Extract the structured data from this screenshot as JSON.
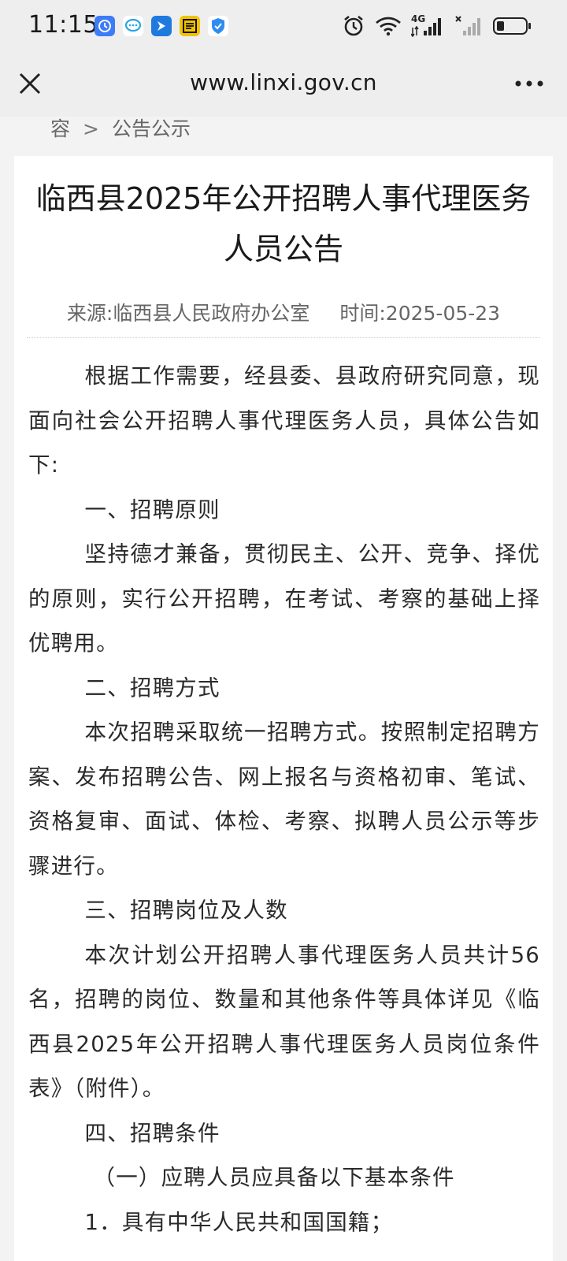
{
  "status_bar": {
    "time": "11:15",
    "app_icons": [
      {
        "name": "clock-app-icon",
        "color": "#3d7bf7",
        "glyph": "⏰"
      },
      {
        "name": "chat-app-icon",
        "color": "#ffffff",
        "glyph": "💬"
      },
      {
        "name": "arrow-app-icon",
        "color": "#1f7ae0",
        "glyph": "➤"
      },
      {
        "name": "news-app-icon",
        "color": "#f2c200",
        "glyph": "哔"
      },
      {
        "name": "shield-app-icon",
        "color": "#ffffff",
        "glyph": "🛡"
      }
    ],
    "network_label": "4G",
    "battery_level": 0.25
  },
  "nav": {
    "url": "www.linxi.gov.cn"
  },
  "breadcrumb": {
    "prev": "容",
    "separator": ">",
    "current": "公告公示"
  },
  "article": {
    "title": "临西县2025年公开招聘人事代理医务人员公告",
    "source_label": "来源:",
    "source": "临西县人民政府办公室",
    "time_label": "时间:",
    "time": "2025-05-23",
    "paragraphs": [
      {
        "type": "indent",
        "text": "根据工作需要，经县委、县政府研究同意，现面向社会公开招聘人事代理医务人员，具体公告如下:"
      },
      {
        "type": "heading",
        "text": "一、招聘原则"
      },
      {
        "type": "indent",
        "text": "坚持德才兼备，贯彻民主、公开、竞争、择优的原则，实行公开招聘，在考试、考察的基础上择优聘用。"
      },
      {
        "type": "heading",
        "text": "二、招聘方式"
      },
      {
        "type": "indent",
        "text": "本次招聘采取统一招聘方式。按照制定招聘方案、发布招聘公告、网上报名与资格初审、笔试、资格复审、面试、体检、考察、拟聘人员公示等步骤进行。"
      },
      {
        "type": "heading",
        "text": "三、招聘岗位及人数"
      },
      {
        "type": "indent",
        "text": " 本次计划公开招聘人事代理医务人员共计56名，招聘的岗位、数量和其他条件等具体详见《临西县2025年公开招聘人事代理医务人员岗位条件表》（附件）。"
      },
      {
        "type": "heading",
        "text": "四、招聘条件"
      },
      {
        "type": "sub",
        "text": "（一）应聘人员应具备以下基本条件"
      },
      {
        "type": "indent",
        "text": "1．具有中华人民共和国国籍；"
      }
    ]
  }
}
